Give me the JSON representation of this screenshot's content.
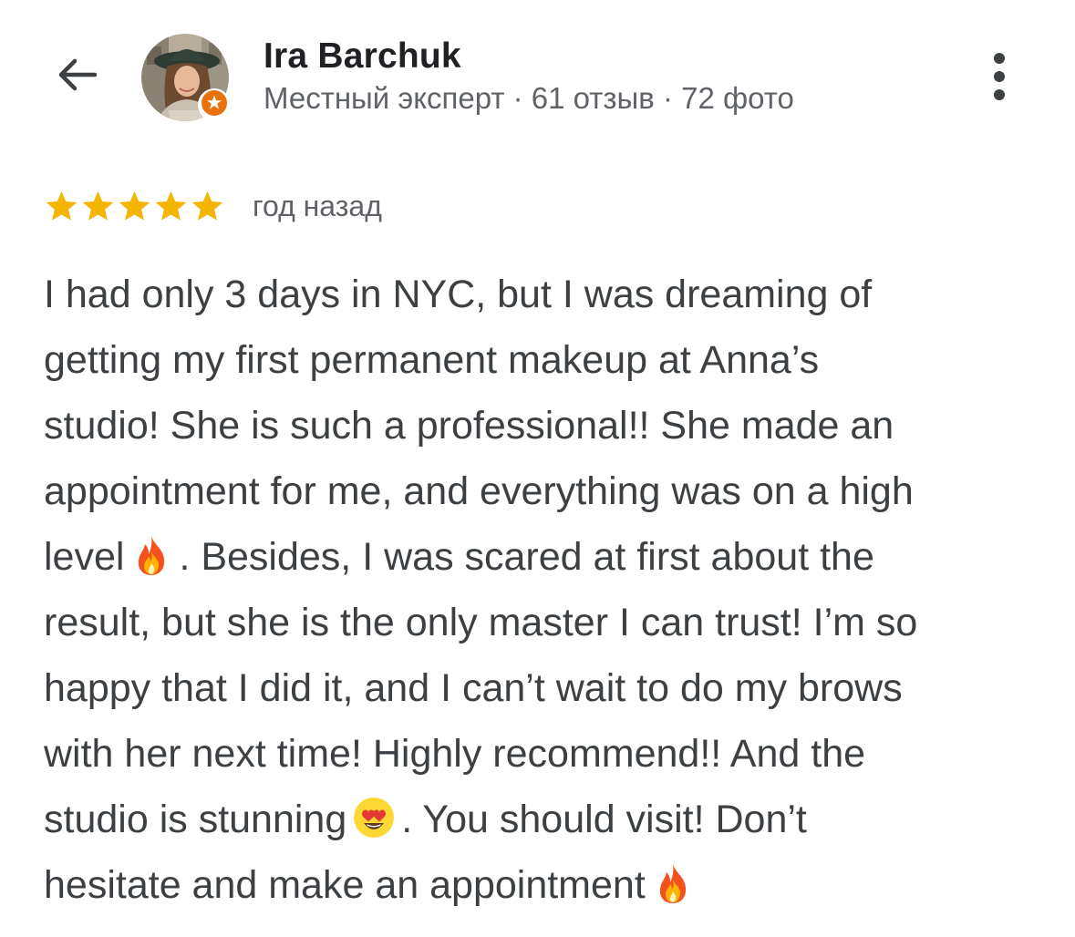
{
  "header": {
    "back_icon": "arrow-back-icon",
    "author_name": "Ira Barchuk",
    "author_meta": "Местный эксперт · 61 отзыв · 72 фото",
    "badge_icon": "local-guide-star-icon",
    "menu_icon": "more-vertical-icon"
  },
  "review": {
    "rating": 5,
    "rating_max": 5,
    "time_ago": "год назад",
    "lines": [
      "I had only 3 days in NYC, but I was dreaming of",
      "getting my first permanent makeup at Anna’s",
      "studio! She is such a professional!! She made an",
      "appointment for me, and everything was on a high",
      "level",
      ". Besides, I was scared at first about the",
      "result, but she is the only master I can trust! I’m so",
      "happy that I did it, and I can’t wait to do my brows",
      "with her next time! Highly recommend!! And the",
      "studio is stunning",
      ". You should visit! Don’t",
      "hesitate and make an appointment"
    ]
  },
  "colors": {
    "star": "#f4b400",
    "badge": "#e8710a",
    "secondary_text": "#5f6368",
    "body_text": "#3c4043"
  }
}
